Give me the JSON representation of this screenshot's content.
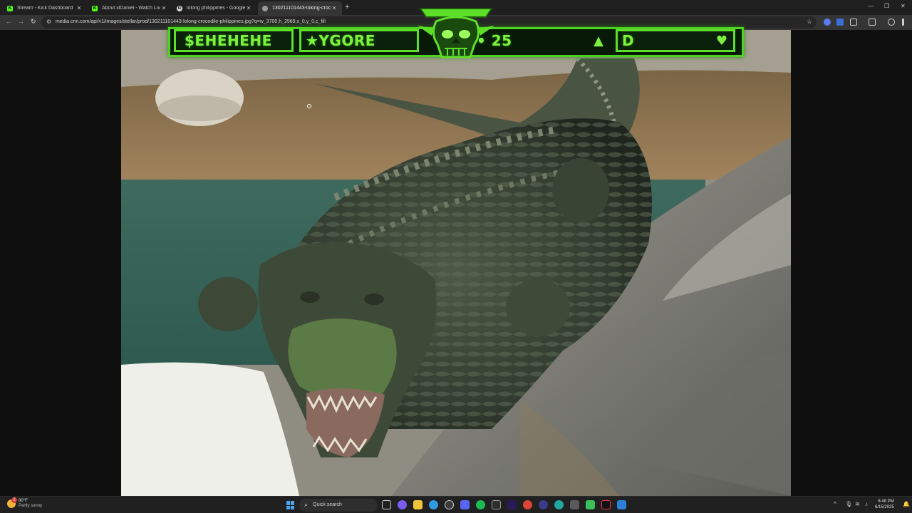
{
  "browser": {
    "tabs": [
      {
        "title": "Stream - Kick Dashboard",
        "favicon_color": "#53fc18",
        "favicon_letter": "K"
      },
      {
        "title": "About xlDaniel - Watch Live on",
        "favicon_color": "#53fc18",
        "favicon_letter": "K"
      },
      {
        "title": "lolong philippines - Google Sea",
        "favicon_color": "#dcdcdc",
        "favicon_letter": "G"
      },
      {
        "title": "130211101443-lolong-crocodil",
        "favicon_color": "#9a9a9a",
        "favicon_letter": ""
      }
    ],
    "new_tab_symbol": "+",
    "url": "media.cnn.com/api/v1/images/stellar/prod/130211101443-lolong-crocodile-philippines.jpg?q=w_3700,h_2569,x_0,y_0,c_fill"
  },
  "overlay": {
    "box1_text": "$EHEHEHE",
    "box2_text": "★YGORE",
    "box3_text": "• 25",
    "box4_text": "D",
    "accent_color": "#5ee02a"
  },
  "taskbar": {
    "weather_temp": "80°F",
    "weather_desc": "Partly sunny",
    "weather_alert_count": "2",
    "search_placeholder": "Quick search",
    "time": "6:48 PM",
    "date": "6/15/2025"
  }
}
